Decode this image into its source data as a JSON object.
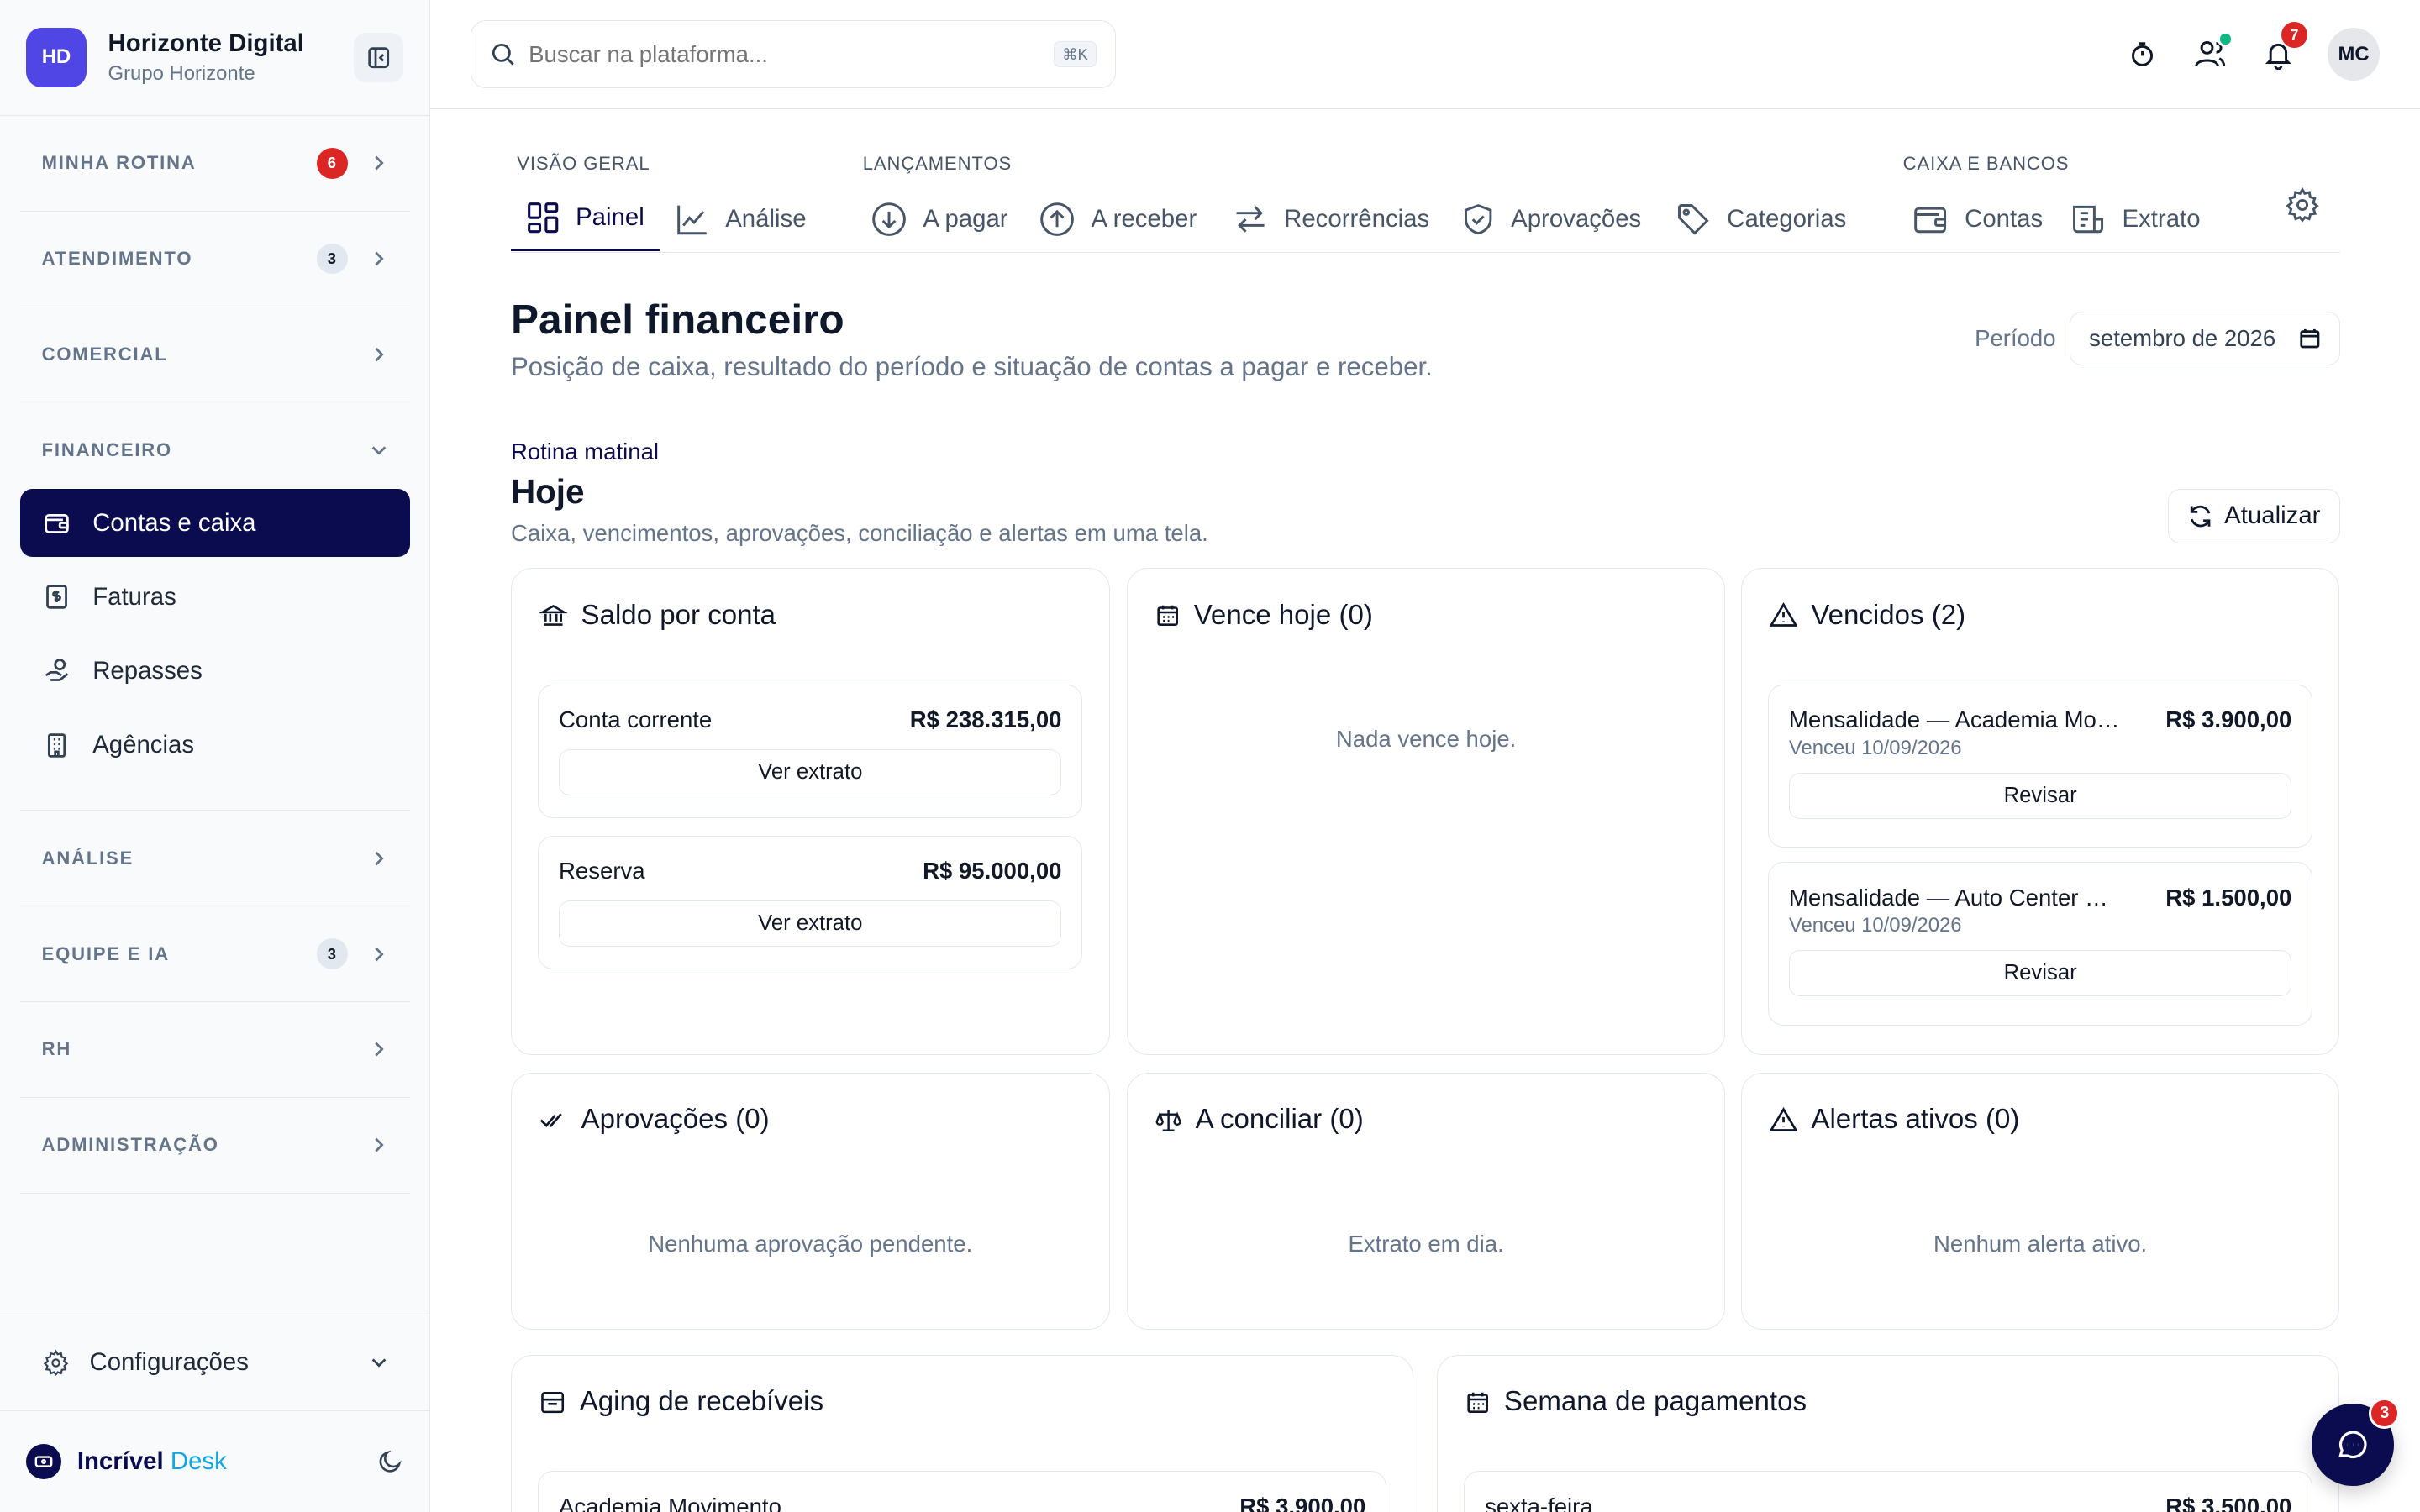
{
  "brand": {
    "initials": "HD",
    "name": "Horizonte Digital",
    "sub": "Grupo Horizonte"
  },
  "sidebar": {
    "sections": [
      {
        "label": "MINHA ROTINA",
        "badge": "6",
        "badge_style": "red"
      },
      {
        "label": "ATENDIMENTO",
        "badge": "3",
        "badge_style": "gray"
      },
      {
        "label": "COMERCIAL"
      }
    ],
    "financeiro": {
      "label": "FINANCEIRO",
      "items": [
        {
          "label": "Contas e caixa",
          "active": true
        },
        {
          "label": "Faturas"
        },
        {
          "label": "Repasses"
        },
        {
          "label": "Agências"
        }
      ]
    },
    "sections_after": [
      {
        "label": "ANÁLISE"
      },
      {
        "label": "EQUIPE E IA",
        "badge": "3"
      },
      {
        "label": "RH"
      },
      {
        "label": "ADMINISTRAÇÃO"
      }
    ],
    "config_label": "Configurações",
    "footer": {
      "name_a": "Incrível",
      "name_b": "Desk"
    }
  },
  "topbar": {
    "search_placeholder": "Buscar na plataforma...",
    "shortcut": "⌘K",
    "notifications_count": "7",
    "avatar": "MC"
  },
  "tabs": {
    "groups": [
      "VISÃO GERAL",
      "LANÇAMENTOS",
      "CAIXA E BANCOS"
    ],
    "items": [
      "Painel",
      "Análise",
      "A pagar",
      "A receber",
      "Recorrências",
      "Aprovações",
      "Categorias",
      "Contas",
      "Extrato"
    ]
  },
  "header": {
    "title": "Painel financeiro",
    "subtitle": "Posição de caixa, resultado do período e situação de contas a pagar e receber.",
    "period_label": "Período",
    "period_value": "setembro de 2026"
  },
  "routine": {
    "kicker": "Rotina matinal",
    "title": "Hoje",
    "subtitle": "Caixa, vencimentos, aprovações, conciliação e alertas em uma tela.",
    "refresh_label": "Atualizar"
  },
  "cards": {
    "saldo": {
      "title": "Saldo por conta",
      "accounts": [
        {
          "name": "Conta corrente",
          "amount": "R$ 238.315,00",
          "action": "Ver extrato"
        },
        {
          "name": "Reserva",
          "amount": "R$ 95.000,00",
          "action": "Ver extrato"
        }
      ]
    },
    "vence_hoje": {
      "title": "Vence hoje (0)",
      "empty": "Nada vence hoje."
    },
    "vencidos": {
      "title": "Vencidos (2)",
      "items": [
        {
          "name": "Mensalidade — Academia Movimento",
          "amount": "R$ 3.900,00",
          "date": "Venceu 10/09/2026",
          "action": "Revisar"
        },
        {
          "name": "Mensalidade — Auto Center Horizonte",
          "amount": "R$ 1.500,00",
          "date": "Venceu 10/09/2026",
          "action": "Revisar"
        }
      ]
    },
    "aprovacoes": {
      "title": "Aprovações (0)",
      "empty": "Nenhuma aprovação pendente."
    },
    "conciliar": {
      "title": "A conciliar (0)",
      "empty": "Extrato em dia."
    },
    "alertas": {
      "title": "Alertas ativos (0)",
      "empty": "Nenhum alerta ativo."
    },
    "aging": {
      "title": "Aging de recebíveis",
      "row_name": "Academia Movimento",
      "row_amount": "R$ 3.900,00"
    },
    "semana": {
      "title": "Semana de pagamentos",
      "row_name": "sexta-feira",
      "row_amount": "R$ 3.500,00"
    }
  },
  "fab": {
    "badge": "3"
  },
  "colors": {
    "primary": "#0b0b4f",
    "brand": "#4f46e5",
    "danger": "#dc2626",
    "success": "#10b981"
  }
}
